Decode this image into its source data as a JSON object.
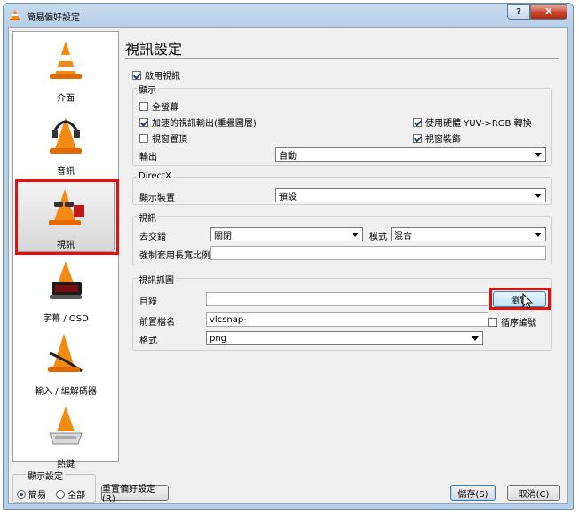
{
  "window": {
    "title": "簡易偏好設定",
    "help": "?",
    "close": "X"
  },
  "sidebar": {
    "items": [
      {
        "label": "介面",
        "icon": "vlc-cone-icon"
      },
      {
        "label": "音訊",
        "icon": "headphones-cone-icon"
      },
      {
        "label": "視訊",
        "icon": "glasses-cone-icon"
      },
      {
        "label": "字幕 / OSD",
        "icon": "clock-cone-icon"
      },
      {
        "label": "輸入 / 編解碼器",
        "icon": "cable-cone-icon"
      },
      {
        "label": "熱鍵",
        "icon": "keyboard-cone-icon"
      }
    ],
    "selected": "視訊"
  },
  "display_settings": {
    "legend": "顯示設定",
    "simple": "簡易",
    "all": "全部",
    "selected": "簡易"
  },
  "buttons": {
    "reset": "重置偏好設定(R)",
    "save": "儲存(S)",
    "cancel": "取消(C)"
  },
  "main": {
    "title": "視訊設定",
    "enable_video": {
      "label": "啟用視訊",
      "checked": true
    },
    "display": {
      "legend": "顯示",
      "fullscreen": {
        "label": "全螢幕",
        "checked": false
      },
      "accel": {
        "label": "加速的視訊輸出(重疊圖層)",
        "checked": true
      },
      "hw_yuv": {
        "label": "使用硬體 YUV->RGB 轉換",
        "checked": true
      },
      "on_top": {
        "label": "視窗置頂",
        "checked": false
      },
      "decorations": {
        "label": "視窗裝飾",
        "checked": true
      },
      "output_label": "輸出",
      "output_value": "自動"
    },
    "directx": {
      "legend": "DirectX",
      "device_label": "顯示裝置",
      "device_value": "預設"
    },
    "video": {
      "legend": "視訊",
      "deinterlace_label": "去交錯",
      "deinterlace_value": "關閉",
      "mode_label": "模式",
      "mode_value": "混合",
      "aspect_label": "強制套用長寬比例",
      "aspect_value": ""
    },
    "snapshot": {
      "legend": "視訊抓圖",
      "dir_label": "目錄",
      "dir_value": "",
      "browse": "瀏覽",
      "prefix_label": "前置檔名",
      "prefix_value": "vlcsnap-",
      "sequential": {
        "label": "循序編號",
        "checked": false
      },
      "format_label": "格式",
      "format_value": "png"
    }
  },
  "colors": {
    "highlight": "#e21010",
    "cone_orange": "#f28a14"
  }
}
